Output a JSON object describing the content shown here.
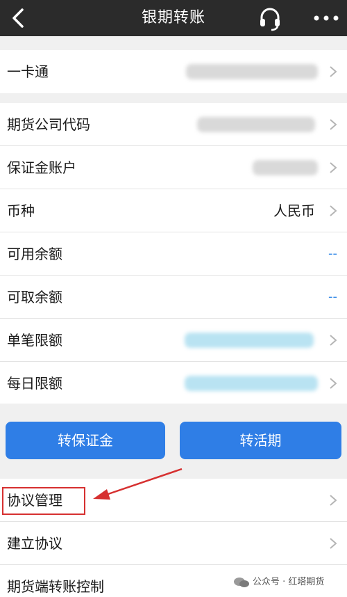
{
  "header": {
    "title": "银期转账",
    "back_icon": "chevron-left-icon",
    "service_icon": "headset-icon",
    "more_icon": "more-dots-icon"
  },
  "card_row": {
    "label": "一卡通"
  },
  "details": {
    "futures_company_code": {
      "label": "期货公司代码"
    },
    "margin_account": {
      "label": "保证金账户"
    },
    "currency": {
      "label": "币种",
      "value": "人民币"
    },
    "available_balance": {
      "label": "可用余额",
      "value": "--"
    },
    "withdrawable_balance": {
      "label": "可取余额",
      "value": "--"
    },
    "single_limit": {
      "label": "单笔限额"
    },
    "daily_limit": {
      "label": "每日限额"
    }
  },
  "actions": {
    "transfer_to_margin": "转保证金",
    "transfer_to_current": "转活期"
  },
  "menu": {
    "agreement_management": "协议管理",
    "create_agreement": "建立协议",
    "futures_transfer_control": "期货端转账控制"
  },
  "watermark": {
    "text": "公众号 · 红塔期货"
  },
  "colors": {
    "header_bg": "#2b2b2b",
    "button_blue": "#2f7ee6",
    "dash_blue": "#3a8de8",
    "annotation_red": "#d63030"
  }
}
